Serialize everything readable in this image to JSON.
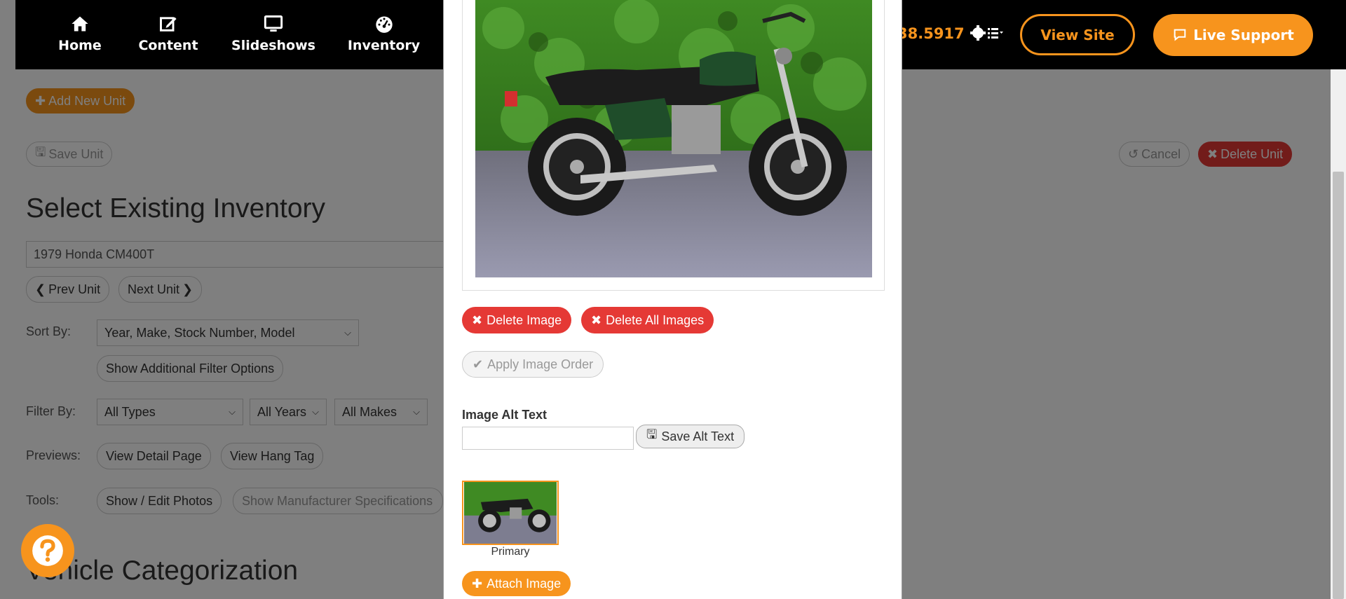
{
  "nav": {
    "items": [
      {
        "label": "Home",
        "icon": "home-icon"
      },
      {
        "label": "Content",
        "icon": "edit-icon"
      },
      {
        "label": "Slideshows",
        "icon": "monitor-icon"
      },
      {
        "label": "Inventory",
        "icon": "dashboard-icon"
      }
    ],
    "phone": "38.5917",
    "view_site": "View Site",
    "live_support": "Live Support"
  },
  "page": {
    "add_new_unit": "Add New Unit",
    "save_unit": "Save Unit",
    "cancel": "Cancel",
    "delete_unit": "Delete Unit",
    "heading": "Select Existing Inventory",
    "selected_unit": "1979 Honda CM400T",
    "prev_unit": "Prev Unit",
    "next_unit": "Next Unit",
    "sort_by_label": "Sort By:",
    "sort_by_value": "Year, Make, Stock Number, Model",
    "show_filter_options": "Show Additional Filter Options",
    "filter_by_label": "Filter By:",
    "filter_types": "All Types",
    "filter_years": "All Years",
    "filter_makes": "All Makes",
    "previews_label": "Previews:",
    "view_detail_page": "View Detail Page",
    "view_hang_tag": "View Hang Tag",
    "tools_label": "Tools:",
    "show_edit_photos": "Show / Edit Photos",
    "show_manufacturer_specs": "Show Manufacturer Specifications",
    "section_heading": "Vehicle Categorization"
  },
  "modal": {
    "delete_image": "Delete Image",
    "delete_all_images": "Delete All Images",
    "apply_image_order": "Apply Image Order",
    "alt_text_label": "Image Alt Text",
    "alt_text_value": "",
    "save_alt_text": "Save Alt Text",
    "thumb_caption": "Primary",
    "attach_image": "Attach Image"
  },
  "colors": {
    "accent": "#f7941d",
    "danger": "#e53935",
    "nav_bg": "#000000"
  }
}
